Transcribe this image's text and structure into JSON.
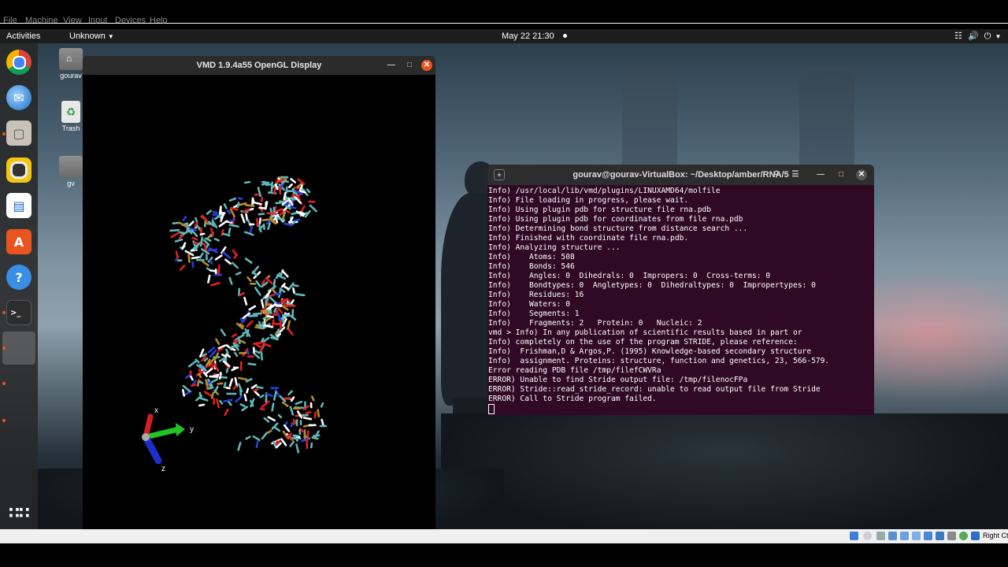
{
  "host_menu": {
    "items": [
      "File",
      "Machine",
      "View",
      "Input",
      "Devices",
      "Help"
    ]
  },
  "topbar": {
    "activities": "Activities",
    "app_menu": "Unknown",
    "clock": "May 22  21:30"
  },
  "desktop_icons": [
    {
      "label": "gourav",
      "icon": "home-folder-icon"
    },
    {
      "label": "Trash",
      "icon": "trash-icon"
    },
    {
      "label": "gv",
      "icon": "folder-icon"
    }
  ],
  "dock": {
    "items": [
      "chrome-icon",
      "thunderbird-icon",
      "files-icon",
      "rhythmbox-icon",
      "writer-icon",
      "software-icon",
      "help-icon",
      "terminal-icon",
      "vmd-app-icon"
    ],
    "show_apps": "show-applications-icon"
  },
  "vmd_window": {
    "title": "VMD 1.9.4a55 OpenGL Display",
    "axes": {
      "x": "x",
      "y": "y",
      "z": "z"
    }
  },
  "terminal": {
    "title": "gourav@gourav-VirtualBox: ~/Desktop/amber/RNA/5",
    "lines": [
      "Info) /usr/local/lib/vmd/plugins/LINUXAMD64/molfile",
      "Info) File loading in progress, please wait.",
      "Info) Using plugin pdb for structure file rna.pdb",
      "Info) Using plugin pdb for coordinates from file rna.pdb",
      "Info) Determining bond structure from distance search ...",
      "Info) Finished with coordinate file rna.pdb.",
      "Info) Analyzing structure ...",
      "Info)    Atoms: 508",
      "Info)    Bonds: 546",
      "Info)    Angles: 0  Dihedrals: 0  Impropers: 0  Cross-terms: 0",
      "Info)    Bondtypes: 0  Angletypes: 0  Dihedraltypes: 0  Impropertypes: 0",
      "Info)    Residues: 16",
      "Info)    Waters: 0",
      "Info)    Segments: 1",
      "Info)    Fragments: 2   Protein: 0   Nucleic: 2",
      "vmd > Info) In any publication of scientific results based in part or",
      "Info) completely on the use of the program STRIDE, please reference:",
      "Info)  Frishman,D & Argos,P. (1995) Knowledge-based secondary structure",
      "Info)  assignment. Proteins: structure, function and genetics, 23, 566-579.",
      "Error reading PDB file /tmp/filefCWVRa",
      "ERROR) Unable to find Stride output file: /tmp/filenocFPa",
      "ERROR) Stride::read_stride_record: unable to read output file from Stride",
      "ERROR) Call to Stride program failed."
    ]
  },
  "status": {
    "host_key": "Right Ctrl"
  },
  "colors": {
    "terminal_bg": "#300a24",
    "accent": "#e95420"
  }
}
